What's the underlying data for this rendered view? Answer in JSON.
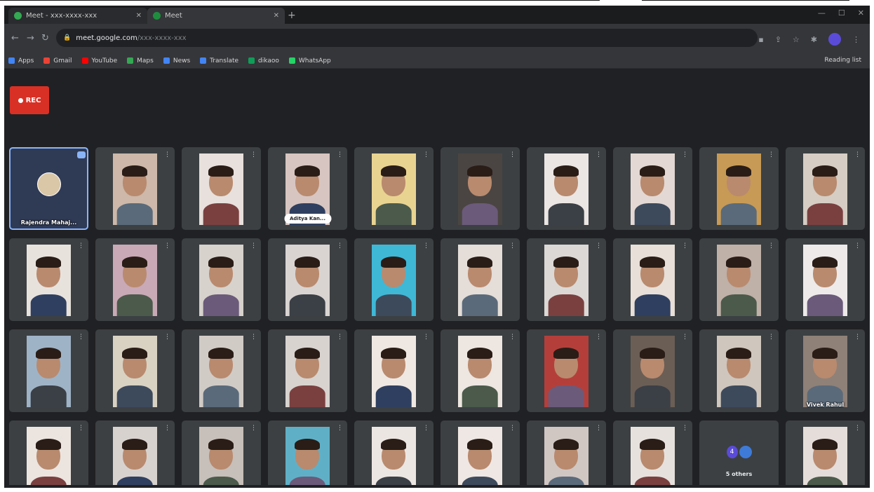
{
  "browser": {
    "tabs": [
      {
        "title": "Meet - xxx-xxxx-xxx",
        "favicon_color": "#34a853"
      },
      {
        "title": "Meet",
        "favicon_color": "#1e8e3e"
      }
    ],
    "new_tab_label": "+",
    "url": "meet.google.com",
    "url_path": "/xxx-xxxx-xxx",
    "bookmarks": [
      {
        "label": "Apps",
        "color": "#4285f4"
      },
      {
        "label": "Gmail",
        "color": "#ea4335"
      },
      {
        "label": "YouTube",
        "color": "#ff0000"
      },
      {
        "label": "Maps",
        "color": "#34a853"
      },
      {
        "label": "News",
        "color": "#4285f4"
      },
      {
        "label": "Translate",
        "color": "#4285f4"
      },
      {
        "label": "dikaoo",
        "color": "#0f9d58"
      },
      {
        "label": "WhatsApp",
        "color": "#25d366"
      }
    ],
    "reading_list": "Reading list"
  },
  "meet": {
    "rec_label": "REC",
    "others_count": "4",
    "others_label": "5 others"
  },
  "participants": [
    {
      "name": "Rajendra Mahaj...",
      "type": "avatar",
      "active": true
    },
    {
      "name": "",
      "type": "video",
      "bg": "#cdb8a9"
    },
    {
      "name": "",
      "type": "video",
      "bg": "#e8e0dc"
    },
    {
      "name": "Aditya Kan...",
      "type": "pill",
      "bg": "#d7c5c1"
    },
    {
      "name": "",
      "type": "pill",
      "bg": "#e9d391"
    },
    {
      "name": "",
      "type": "pill",
      "bg": "#4a4542"
    },
    {
      "name": "",
      "type": "video",
      "bg": "#ebe6e3"
    },
    {
      "name": "",
      "type": "pill",
      "bg": "#e3d8d3"
    },
    {
      "name": "",
      "type": "pill",
      "bg": "#c79a55"
    },
    {
      "name": "",
      "type": "video",
      "bg": "#d6cdc4"
    },
    {
      "name": "",
      "type": "video",
      "bg": "#e8e2dd"
    },
    {
      "name": "",
      "type": "video",
      "bg": "#c9a9b6"
    },
    {
      "name": "",
      "type": "video",
      "bg": "#d7d2cc"
    },
    {
      "name": "",
      "type": "video",
      "bg": "#d9d4d2"
    },
    {
      "name": "",
      "type": "video",
      "bg": "#3fb8d6"
    },
    {
      "name": "",
      "type": "video",
      "bg": "#e4ddd8"
    },
    {
      "name": "",
      "type": "video",
      "bg": "#dcd8d5"
    },
    {
      "name": "",
      "type": "video",
      "bg": "#e7dfd8"
    },
    {
      "name": "",
      "type": "video",
      "bg": "#bfb0a8"
    },
    {
      "name": "",
      "type": "video",
      "bg": "#eeeaea"
    },
    {
      "name": "",
      "type": "video",
      "bg": "#9fb3c6"
    },
    {
      "name": "",
      "type": "video",
      "bg": "#d9d2c2"
    },
    {
      "name": "",
      "type": "video",
      "bg": "#d1cbc6"
    },
    {
      "name": "",
      "type": "video",
      "bg": "#d8d3cf"
    },
    {
      "name": "",
      "type": "video",
      "bg": "#efe8e2"
    },
    {
      "name": "",
      "type": "video",
      "bg": "#ede6e1"
    },
    {
      "name": "",
      "type": "video",
      "bg": "#b43f3a"
    },
    {
      "name": "",
      "type": "video",
      "bg": "#6b5e55"
    },
    {
      "name": "",
      "type": "video",
      "bg": "#cfc6bd"
    },
    {
      "name": "Vivek Rahul",
      "type": "video",
      "bg": "#8f8178"
    },
    {
      "name": "",
      "type": "video",
      "bg": "#ece4df"
    },
    {
      "name": "",
      "type": "video",
      "bg": "#d8d2cf"
    },
    {
      "name": "",
      "type": "video",
      "bg": "#c7bfb9"
    },
    {
      "name": "",
      "type": "video",
      "bg": "#5fb0c7"
    },
    {
      "name": "",
      "type": "video",
      "bg": "#ece6e2"
    },
    {
      "name": "",
      "type": "video",
      "bg": "#efe7e3"
    },
    {
      "name": "",
      "type": "video",
      "bg": "#d0c7c3"
    },
    {
      "name": "",
      "type": "video",
      "bg": "#e7e1dd"
    },
    {
      "name": "",
      "type": "others"
    },
    {
      "name": "",
      "type": "video",
      "bg": "#e5ddd9"
    }
  ]
}
